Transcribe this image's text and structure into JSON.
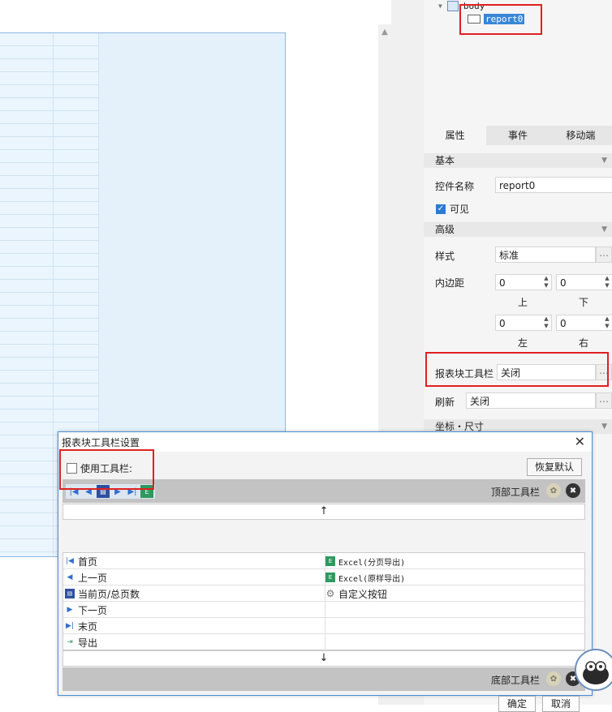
{
  "tree": {
    "body_label": "body",
    "report_label": "report0"
  },
  "tabs": [
    "属性",
    "事件",
    "移动端"
  ],
  "sections": {
    "basic": "基本",
    "advanced": "高级",
    "coords": "坐标・尺寸"
  },
  "props": {
    "control_name_label": "控件名称",
    "control_name_value": "report0",
    "visible_label": "可见",
    "style_label": "样式",
    "style_value": "标准",
    "padding_label": "内边距",
    "padding_top": "0",
    "padding_bottom": "0",
    "padding_left": "0",
    "padding_right": "0",
    "top_label": "上",
    "bottom_label": "下",
    "left_label": "左",
    "right_label": "右",
    "toolbar_label": "报表块工具栏",
    "toolbar_value": "关闭",
    "refresh_label": "刷新",
    "refresh_value": "关闭"
  },
  "dialog": {
    "title": "报表块工具栏设置",
    "use_toolbar_label": "使用工具栏:",
    "restore_default": "恢复默认",
    "top_bar_label": "顶部工具栏",
    "bottom_bar_label": "底部工具栏",
    "up_arrow": "↑",
    "down_arrow": "↓",
    "items_left": [
      "首页",
      "上一页",
      "当前页/总页数",
      "下一页",
      "末页",
      "导出"
    ],
    "items_right": [
      "Excel(分页导出)",
      "Excel(原样导出)",
      "自定义按钮",
      "",
      "",
      ""
    ],
    "ok": "确定",
    "cancel": "取消"
  },
  "icons": {
    "first": "first-page-icon",
    "prev": "prev-page-icon",
    "current": "page-count-icon",
    "next": "next-page-icon",
    "last": "last-page-icon",
    "export": "export-icon",
    "excel": "excel-icon",
    "gear": "gear-icon",
    "close": "close-icon"
  }
}
